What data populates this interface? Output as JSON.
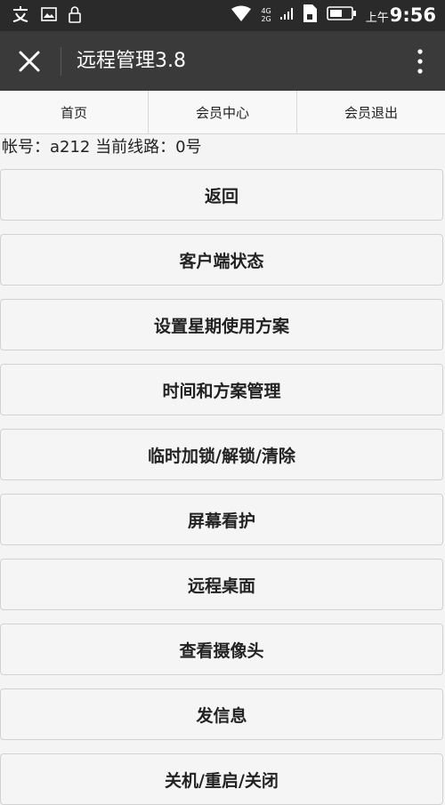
{
  "statusbar": {
    "net1": "4G",
    "net2": "2G",
    "time_prefix": "上午",
    "time": "9:56"
  },
  "appbar": {
    "title": "远程管理3.8"
  },
  "nav": [
    {
      "label": "首页"
    },
    {
      "label": "会员中心"
    },
    {
      "label": "会员退出"
    }
  ],
  "account_line": "帐号：a212  当前线路：0号",
  "menu": [
    {
      "label": "返回"
    },
    {
      "label": "客户端状态"
    },
    {
      "label": "设置星期使用方案"
    },
    {
      "label": "时间和方案管理"
    },
    {
      "label": "临时加锁/解锁/清除"
    },
    {
      "label": "屏幕看护"
    },
    {
      "label": "远程桌面"
    },
    {
      "label": "查看摄像头"
    },
    {
      "label": "发信息"
    },
    {
      "label": "关机/重启/关闭"
    }
  ]
}
